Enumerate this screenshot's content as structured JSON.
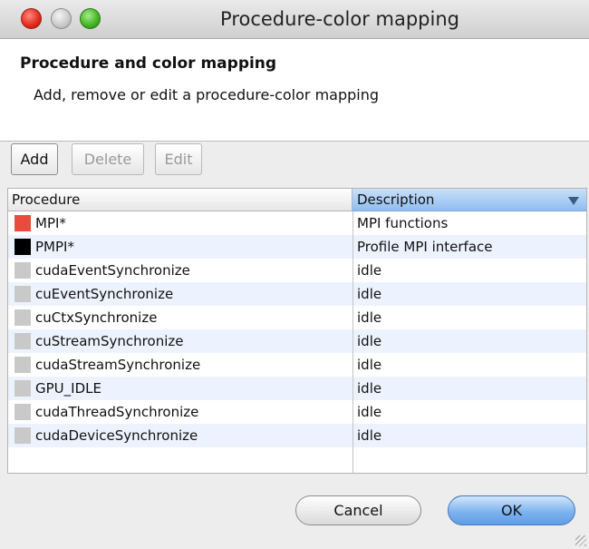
{
  "window": {
    "title": "Procedure-color mapping"
  },
  "header": {
    "title": "Procedure and color mapping",
    "description": "Add, remove or edit a procedure-color mapping"
  },
  "toolbar": {
    "add_label": "Add",
    "delete_label": "Delete",
    "edit_label": "Edit"
  },
  "table": {
    "columns": [
      "Procedure",
      "Description"
    ],
    "rows": [
      {
        "procedure": "MPI*",
        "description": "MPI functions",
        "color": "#e94c3d"
      },
      {
        "procedure": "PMPI*",
        "description": "Profile MPI interface",
        "color": "#000000"
      },
      {
        "procedure": "cudaEventSynchronize",
        "description": "idle",
        "color": "#c9c9c9"
      },
      {
        "procedure": "cuEventSynchronize",
        "description": "idle",
        "color": "#c9c9c9"
      },
      {
        "procedure": "cuCtxSynchronize",
        "description": "idle",
        "color": "#c9c9c9"
      },
      {
        "procedure": "cuStreamSynchronize",
        "description": "idle",
        "color": "#c9c9c9"
      },
      {
        "procedure": "cudaStreamSynchronize",
        "description": "idle",
        "color": "#c9c9c9"
      },
      {
        "procedure": "GPU_IDLE",
        "description": "idle",
        "color": "#c9c9c9"
      },
      {
        "procedure": "cudaThreadSynchronize",
        "description": "idle",
        "color": "#c9c9c9"
      },
      {
        "procedure": "cudaDeviceSynchronize",
        "description": "idle",
        "color": "#c9c9c9"
      }
    ]
  },
  "buttons": {
    "cancel_label": "Cancel",
    "ok_label": "OK"
  },
  "colors": {
    "selected_header": "#8fbdf0",
    "alt_row": "#edf3fe",
    "default_button": "#7eb3ef"
  }
}
